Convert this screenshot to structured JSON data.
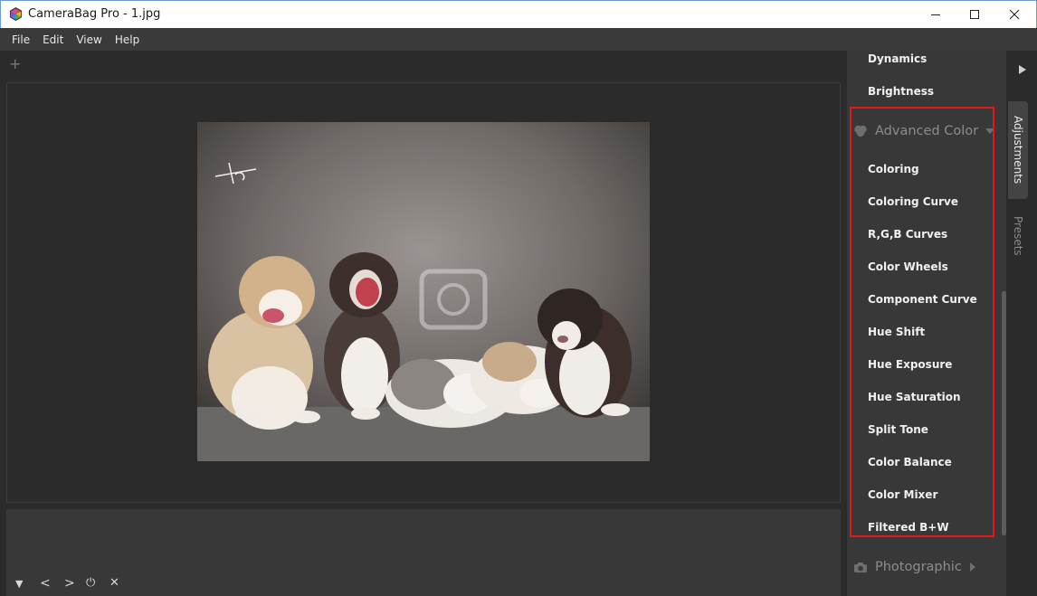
{
  "window": {
    "title": "CameraBag Pro - 1.jpg"
  },
  "menu": [
    "File",
    "Edit",
    "View",
    "Help"
  ],
  "workspace": {
    "add_tab_glyph": "+"
  },
  "filmstrip": {
    "controls": [
      "▼",
      "<",
      ">",
      "⏻",
      "✕"
    ]
  },
  "panel": {
    "items_top": [
      "Dynamics",
      "Brightness"
    ],
    "advanced_color": {
      "label": "Advanced Color",
      "icon": "color-circles-icon",
      "expanded": true,
      "items": [
        "Coloring",
        "Coloring Curve",
        "R,G,B Curves",
        "Color Wheels",
        "Component Curve",
        "Hue Shift",
        "Hue Exposure",
        "Hue Saturation",
        "Split Tone",
        "Color Balance",
        "Color Mixer",
        "Filtered B+W"
      ]
    },
    "photographic": {
      "label": "Photographic",
      "icon": "camera-icon",
      "expanded": false
    },
    "highlight_color": "#e3191c"
  },
  "side_tabs": {
    "active": "Adjustments",
    "inactive": "Presets"
  },
  "colors": {
    "background": "#2b2b2b",
    "panel": "#383838",
    "menubar": "#3a3a3a"
  }
}
